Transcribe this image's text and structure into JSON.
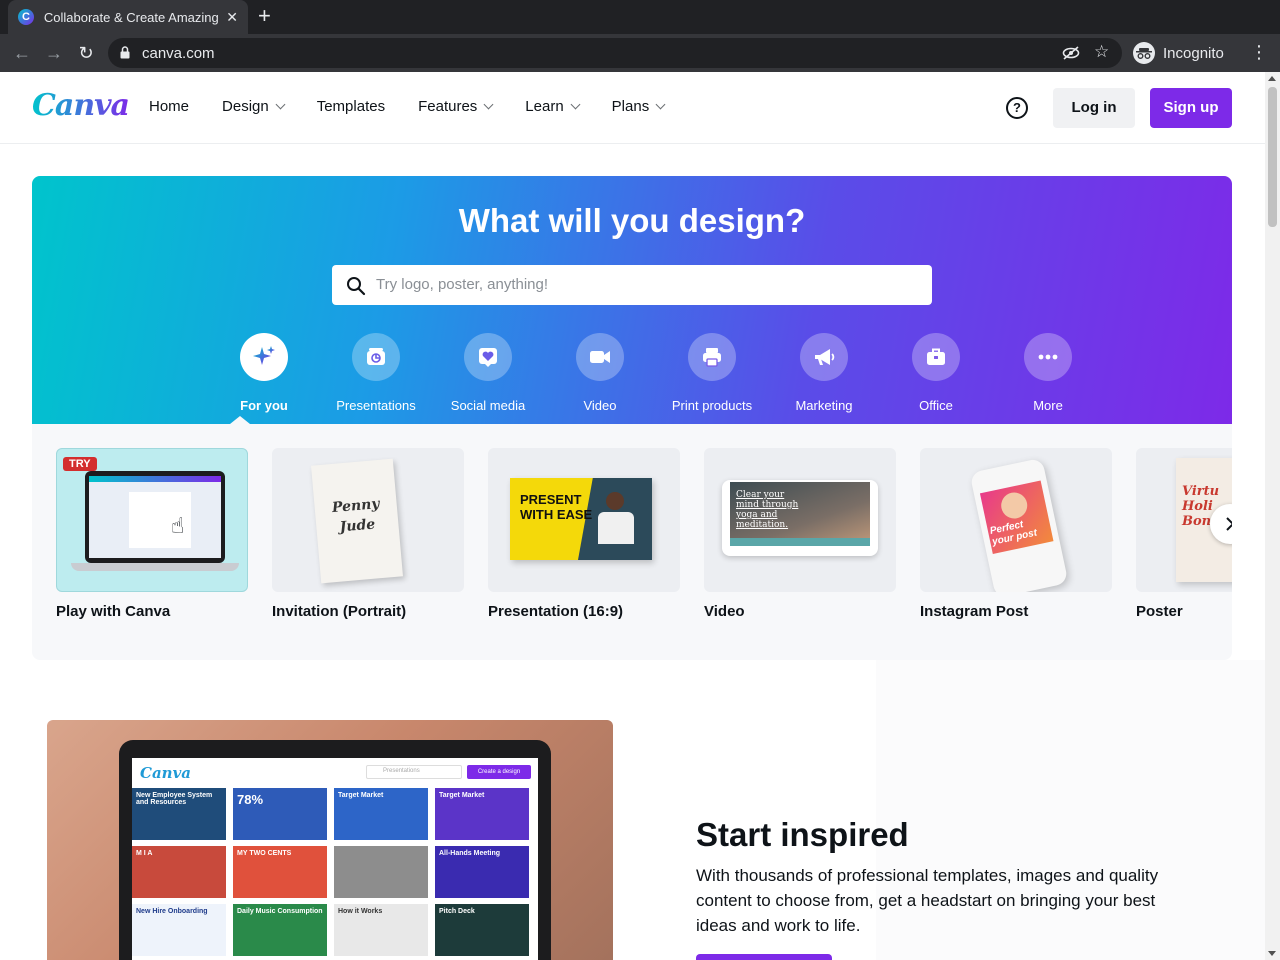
{
  "browser": {
    "tab_title": "Collaborate & Create Amazing Graphic Designs",
    "favicon_letter": "C",
    "url": "canva.com",
    "incognito_label": "Incognito"
  },
  "header": {
    "logo": "Canva",
    "nav": [
      {
        "label": "Home",
        "dropdown": false
      },
      {
        "label": "Design",
        "dropdown": true
      },
      {
        "label": "Templates",
        "dropdown": false
      },
      {
        "label": "Features",
        "dropdown": true
      },
      {
        "label": "Learn",
        "dropdown": true
      },
      {
        "label": "Plans",
        "dropdown": true
      }
    ],
    "help_icon": "?",
    "login": "Log in",
    "signup": "Sign up"
  },
  "hero": {
    "title": "What will you design?",
    "search_placeholder": "Try logo, poster, anything!",
    "categories": [
      {
        "label": "For you",
        "icon": "sparkle-icon",
        "active": true
      },
      {
        "label": "Presentations",
        "icon": "presentation-icon"
      },
      {
        "label": "Social media",
        "icon": "heart-icon"
      },
      {
        "label": "Video",
        "icon": "video-icon"
      },
      {
        "label": "Print products",
        "icon": "printer-icon"
      },
      {
        "label": "Marketing",
        "icon": "megaphone-icon"
      },
      {
        "label": "Office",
        "icon": "briefcase-icon"
      },
      {
        "label": "More",
        "icon": "more-icon"
      }
    ]
  },
  "templates": {
    "items": [
      {
        "label": "Play with Canva",
        "badge": "TRY"
      },
      {
        "label": "Invitation (Portrait)",
        "thumb_text": [
          "Penny",
          "Jude"
        ]
      },
      {
        "label": "Presentation (16:9)",
        "thumb_text": [
          "PRESENT",
          "WITH EASE"
        ]
      },
      {
        "label": "Video",
        "thumb_text": [
          "Clear your",
          "mind through",
          "yoga and",
          "meditation."
        ]
      },
      {
        "label": "Instagram Post",
        "thumb_text": [
          "Perfect",
          "your post"
        ]
      },
      {
        "label": "Poster",
        "thumb_text": [
          "Virtu",
          "Holi",
          "Bon"
        ]
      }
    ]
  },
  "promo": {
    "title": "Start inspired",
    "text": "With thousands of professional templates, images and quality content to choose from, get a headstart on bringing your best ideas and work to life.",
    "screen": {
      "logo": "Canva",
      "search_placeholder": "Presentations",
      "create_button": "Create a design",
      "tiles": [
        "New Employee System and Resources",
        "78%",
        "Target Market",
        "Target Market",
        "M I A",
        "MY TWO CENTS",
        "",
        "All-Hands Meeting",
        "New Hire Onboarding",
        "Daily Music Consumption",
        "How it Works",
        "Pitch Deck"
      ]
    }
  },
  "colors": {
    "brand_purple": "#7d2ae8",
    "brand_teal": "#00c4cc"
  }
}
